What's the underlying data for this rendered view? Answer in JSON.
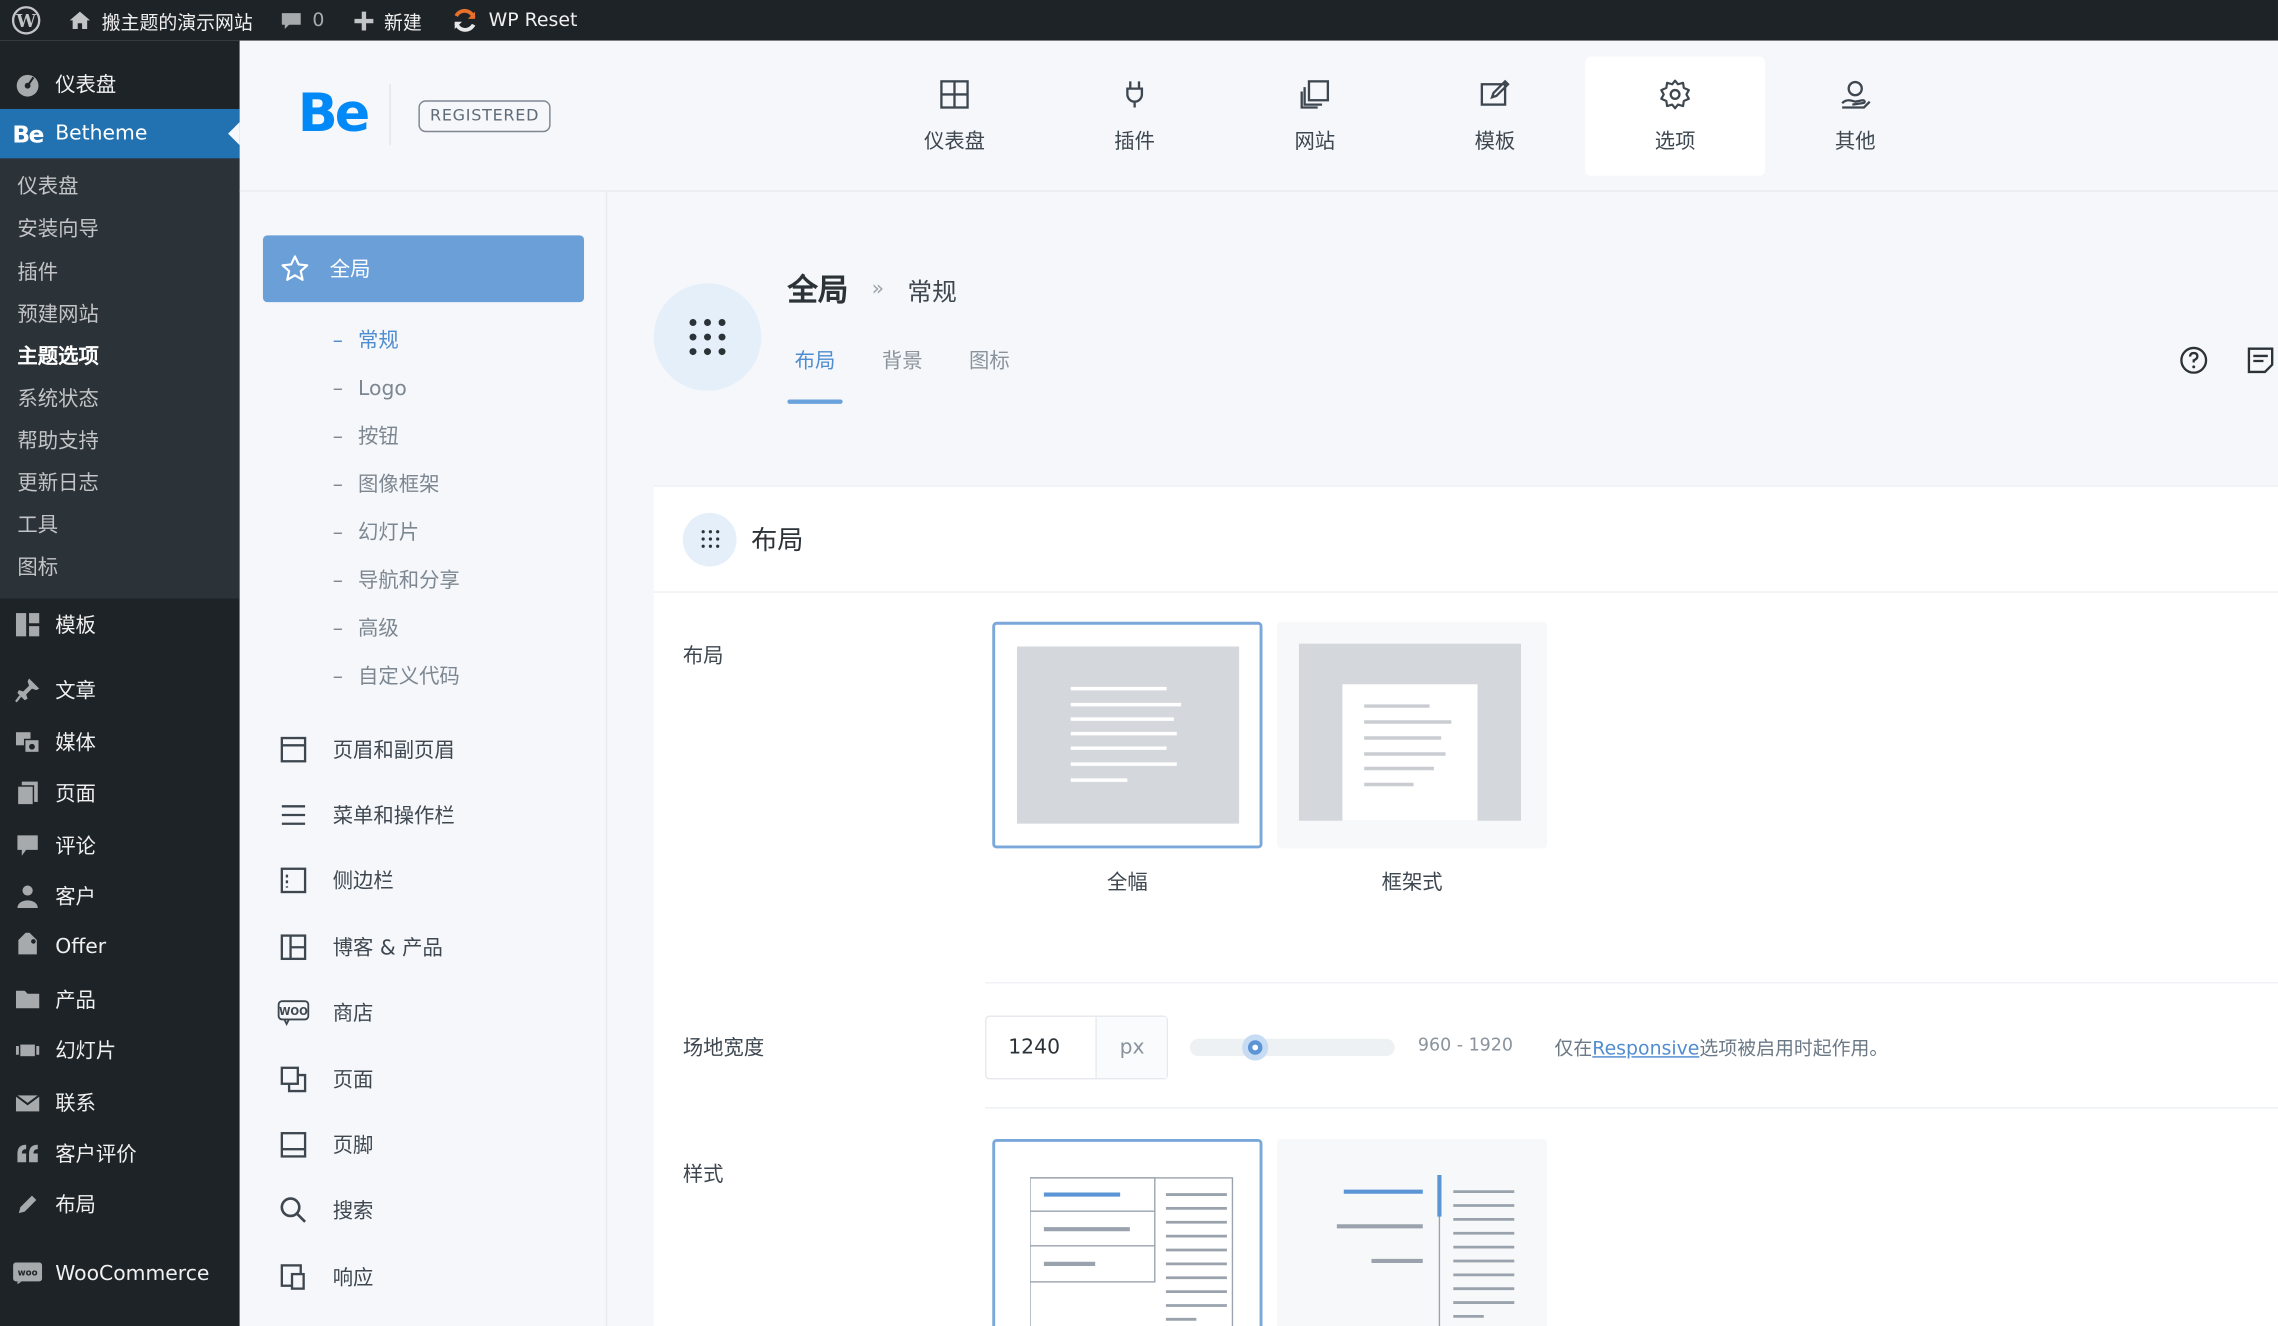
{
  "adminbar": {
    "site_name": "搬主题的演示网站",
    "comments_count": "0",
    "new_label": "新建",
    "wpreset_label": "WP Reset"
  },
  "wp_menu": {
    "dashboard": "仪表盘",
    "betheme": "Betheme",
    "betheme_sub": [
      "仪表盘",
      "安装向导",
      "插件",
      "预建网站",
      "主题选项",
      "系统状态",
      "帮助支持",
      "更新日志",
      "工具",
      "图标"
    ],
    "items": [
      "模板",
      "文章",
      "媒体",
      "页面",
      "评论",
      "客户",
      "Offer",
      "产品",
      "幻灯片",
      "联系",
      "客户评价",
      "布局",
      "WooCommerce"
    ]
  },
  "header": {
    "logo": "Be",
    "registered": "REGISTERED",
    "tabs": [
      "仪表盘",
      "插件",
      "网站",
      "模板",
      "选项",
      "其他"
    ]
  },
  "options_nav": {
    "global": "全局",
    "global_sub": [
      "常规",
      "Logo",
      "按钮",
      "图像框架",
      "幻灯片",
      "导航和分享",
      "高级",
      "自定义代码"
    ],
    "sections": [
      "页眉和副页眉",
      "菜单和操作栏",
      "侧边栏",
      "博客 & 产品",
      "商店",
      "页面",
      "页脚",
      "搜索",
      "响应"
    ],
    "woo_icon_text": "WOO"
  },
  "main": {
    "breadcrumb_title": "全局",
    "breadcrumb_sep": "»",
    "breadcrumb_sub": "常规",
    "tabs": [
      "布局",
      "背景",
      "图标"
    ],
    "panel_title": "布局",
    "layout_label": "布局",
    "layout_options": [
      "全幅",
      "框架式"
    ],
    "width_label": "场地宽度",
    "width_value": "1240",
    "width_unit": "px",
    "width_range": "960 - 1920",
    "width_fraction": 0.292,
    "hint_prefix": "仅在",
    "hint_link": "Responsive",
    "hint_suffix": "选项被启用时起作用。",
    "style_label": "样式"
  },
  "colors": {
    "accent": "#0089f7",
    "wp_admin_dark": "#1d2327",
    "wp_active": "#2271b1",
    "nav_active": "#6a9fd8",
    "link": "#4f8cd0"
  }
}
